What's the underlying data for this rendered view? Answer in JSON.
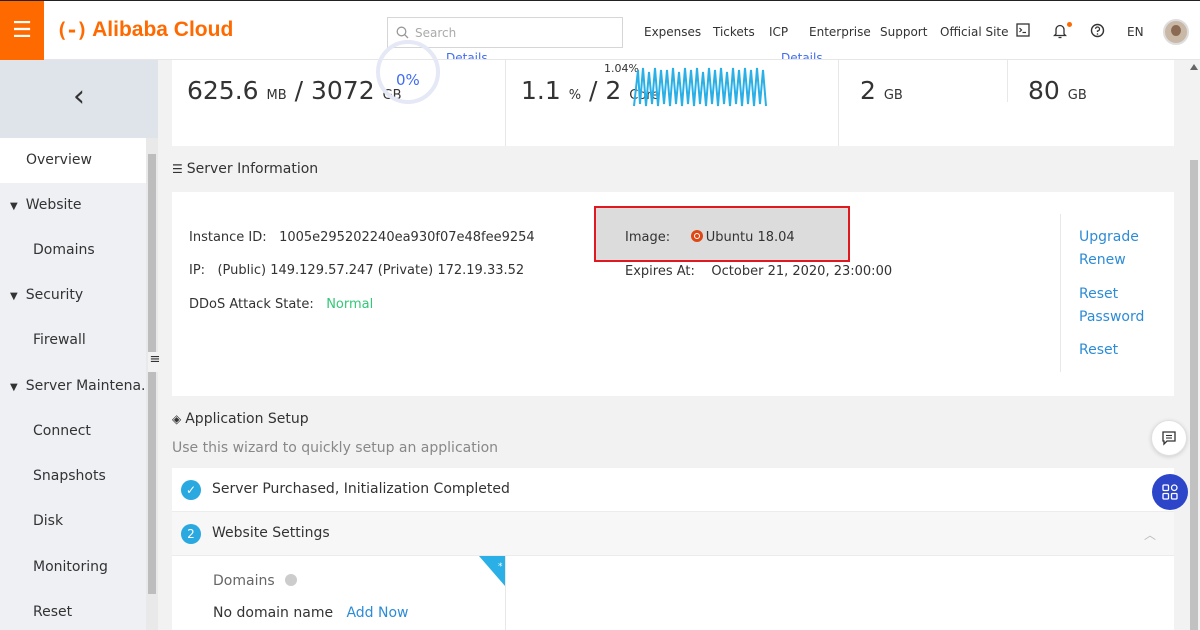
{
  "topbar": {
    "menu_icon": "☰",
    "logo_mark": "(-)",
    "logo_text": "Alibaba Cloud",
    "search_placeholder": "Search",
    "nav": [
      "Expenses",
      "Tickets",
      "ICP",
      "Enterprise",
      "Support",
      "Official Site"
    ],
    "lang": "EN",
    "icons": [
      "terminal-icon",
      "bell-icon",
      "help-icon"
    ]
  },
  "sidebar": {
    "back": "‹",
    "items": [
      {
        "label": "Overview",
        "active": true,
        "group": false
      },
      {
        "label": "Website",
        "group": true
      },
      {
        "label": "Domains",
        "group": false
      },
      {
        "label": "Security",
        "group": true
      },
      {
        "label": "Firewall",
        "group": false
      },
      {
        "label": "Server Maintena...",
        "group": true
      },
      {
        "label": "Connect",
        "group": false
      },
      {
        "label": "Snapshots",
        "group": false
      },
      {
        "label": "Disk",
        "group": false
      },
      {
        "label": "Monitoring",
        "group": false
      },
      {
        "label": "Reset",
        "group": false
      }
    ]
  },
  "metrics": {
    "memory_value": "625.6",
    "memory_unit": "MB",
    "memory_total": "3072",
    "memory_total_unit": "GB",
    "donut_pct": "0%",
    "details": "Details",
    "cpu_value": "1.1",
    "cpu_unit": "%",
    "cpu_total": "2",
    "cpu_total_unit": "Core",
    "cpu_peak": "1.04%",
    "ram_value": "2",
    "ram_unit": "GB",
    "disk_value": "80",
    "disk_unit": "GB"
  },
  "server_info": {
    "title": "Server Information",
    "instance_label": "Instance ID:",
    "instance_id": "1005e295202240ea930f07e48fee9254",
    "ip_label": "IP:",
    "ip_value": "(Public) 149.129.57.247 (Private) 172.19.33.52",
    "ddos_label": "DDoS Attack State:",
    "ddos_value": "Normal",
    "image_label": "Image:",
    "image_value": "Ubuntu 18.04",
    "expires_label": "Expires At:",
    "expires_value": "October 21, 2020, 23:00:00",
    "actions": [
      "Upgrade",
      "Renew",
      "Reset",
      "Password",
      "Reset"
    ]
  },
  "app_setup": {
    "title": "Application Setup",
    "hint": "Use this wizard to quickly setup an application",
    "step1": "Server Purchased, Initialization Completed",
    "step2_num": "2",
    "step2": "Website Settings",
    "domains_label": "Domains",
    "no_domain": "No domain name",
    "add_now": "Add Now"
  },
  "colors": {
    "brand": "#ff6a00",
    "accent": "#3f6cf2",
    "link": "#2d8cd6",
    "highlight_border": "#e0181f"
  }
}
